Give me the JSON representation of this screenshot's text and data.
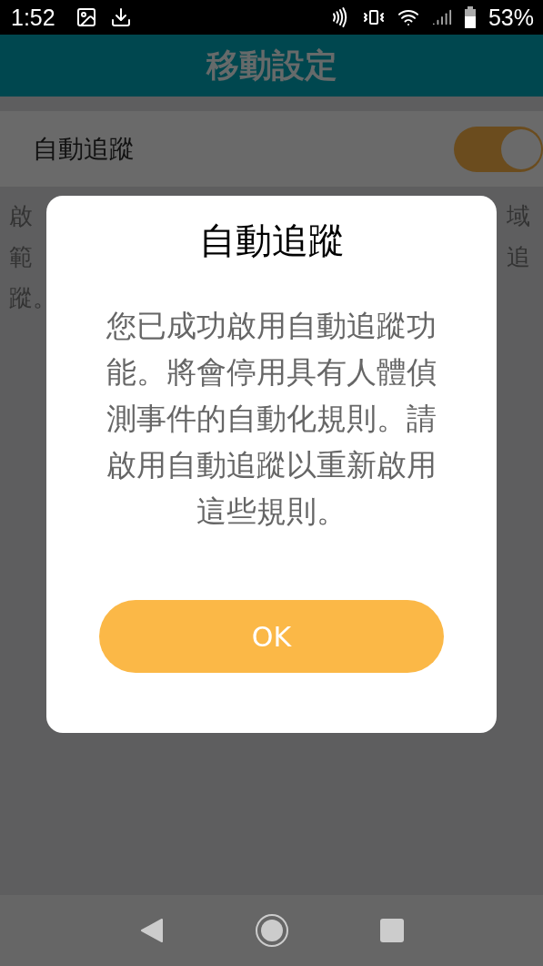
{
  "status_bar": {
    "time": "1:52",
    "battery": "53%"
  },
  "app_bar": {
    "title": "移動設定"
  },
  "setting": {
    "label": "自動追蹤",
    "on": true
  },
  "description_fragments": {
    "left": [
      "啟",
      "範",
      "蹤。"
    ],
    "right": [
      "域",
      "追"
    ]
  },
  "dialog": {
    "title": "自動追蹤",
    "message": "您已成功啟用自動追蹤功能。將會停用具有人體偵測事件的自動化規則。請啟用自動追蹤以重新啟用這些規則。",
    "button": "OK"
  }
}
